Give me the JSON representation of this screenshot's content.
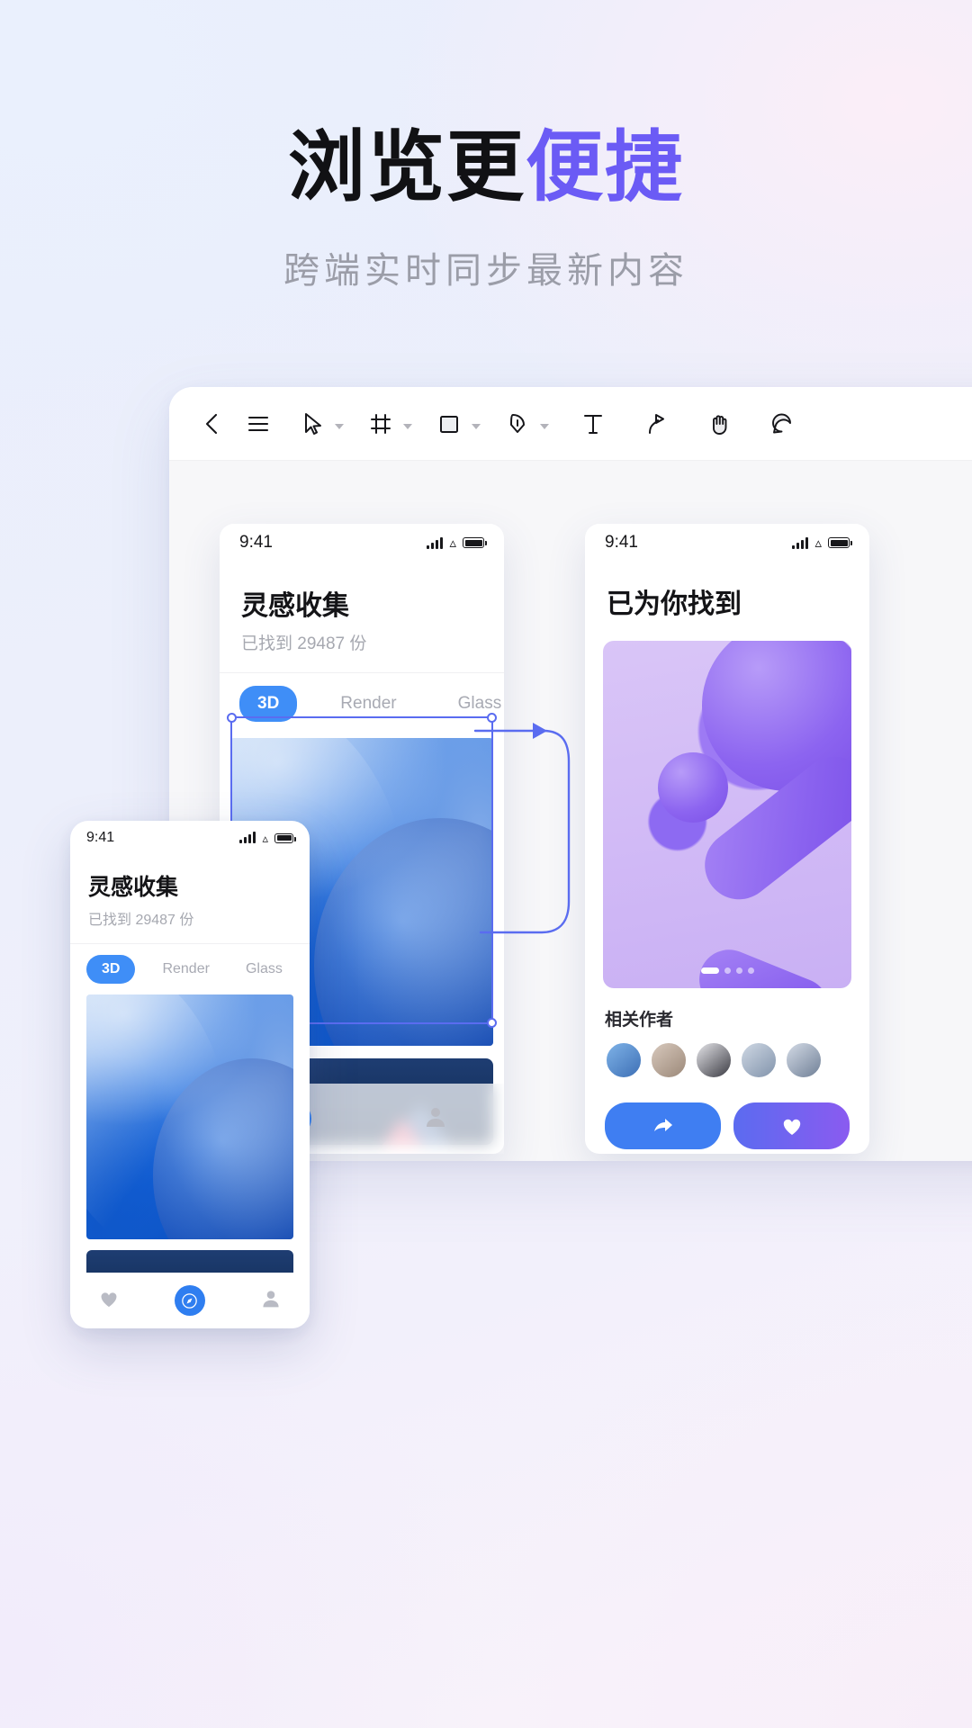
{
  "hero": {
    "headline_plain": "浏览更",
    "headline_accent": "便捷",
    "subheadline": "跨端实时同步最新内容",
    "accent_color": "#6b5bf5"
  },
  "design_app": {
    "toolbar": {
      "back_label": "‹",
      "tools": [
        {
          "name": "back-icon",
          "label": "返回"
        },
        {
          "name": "menu-icon",
          "label": "菜单"
        },
        {
          "name": "cursor-tool-icon",
          "label": "选择工具",
          "has_caret": true
        },
        {
          "name": "frame-tool-icon",
          "label": "画板工具",
          "has_caret": true
        },
        {
          "name": "rectangle-tool-icon",
          "label": "形状工具",
          "has_caret": true
        },
        {
          "name": "pen-tool-icon",
          "label": "钢笔工具",
          "has_caret": true
        },
        {
          "name": "text-tool-icon",
          "label": "文字工具",
          "has_caret": false
        },
        {
          "name": "connector-tool-icon",
          "label": "连线工具",
          "has_caret": false
        },
        {
          "name": "hand-tool-icon",
          "label": "抓手工具",
          "has_caret": false
        },
        {
          "name": "comment-tool-icon",
          "label": "评论",
          "has_caret": false
        }
      ]
    }
  },
  "phone_small": {
    "status_time": "9:41",
    "title": "灵感收集",
    "count_text": "已找到 29487 份",
    "tabs": [
      {
        "label": "3D",
        "active": true
      },
      {
        "label": "Render",
        "active": false
      },
      {
        "label": "Glass",
        "active": false
      }
    ],
    "nav_items": [
      {
        "name": "nav-heart-icon",
        "active": false
      },
      {
        "name": "nav-compass-icon",
        "active": true
      },
      {
        "name": "nav-profile-icon",
        "active": false
      }
    ]
  },
  "phone_center": {
    "status_time": "9:41",
    "title": "灵感收集",
    "count_text": "已找到 29487 份",
    "tabs": [
      {
        "label": "3D",
        "active": true
      },
      {
        "label": "Render",
        "active": false
      },
      {
        "label": "Glass",
        "active": false
      }
    ],
    "nav_items": [
      {
        "name": "nav-compass-icon",
        "active": true
      },
      {
        "name": "nav-profile-icon",
        "active": false
      }
    ]
  },
  "phone_detail": {
    "status_time": "9:41",
    "title": "已为你找到",
    "authors_label": "相关作者",
    "author_count": 5,
    "actions": [
      {
        "name": "share-button",
        "icon": "share-icon",
        "color": "#3f7ef2"
      },
      {
        "name": "like-button",
        "icon": "heart-icon",
        "color": "#6b5bf5"
      }
    ],
    "carousel_dots": 4,
    "carousel_active_index": 0
  }
}
